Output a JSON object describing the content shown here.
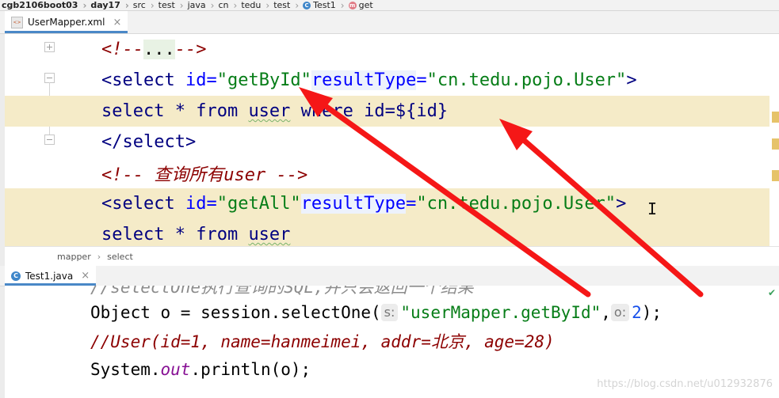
{
  "breadcrumb": [
    "cgb2106boot03",
    "day17",
    "src",
    "test",
    "java",
    "cn",
    "tedu",
    "test",
    "Test1",
    "get"
  ],
  "tabs": {
    "xml_tab": "UserMapper.xml",
    "java_tab": "Test1.java",
    "xml_icon": "<>",
    "java_icon": "C"
  },
  "xml": {
    "collapsed_comment": {
      "open": "<!--",
      "dots": "...",
      "close": "-->"
    },
    "select1": {
      "lt": "<select ",
      "id_attr": "id",
      "eq": "=",
      "id_val": "\"getById\"",
      "rt_attr": "resultType",
      "eq2": "=",
      "rt_val": "\"cn.tedu.pojo.User\"",
      "gt": ">"
    },
    "sql1": {
      "a": "select * from ",
      "b": "user",
      "c": " where id=${id}"
    },
    "close1": "</select>",
    "comment2": "<!-- 查询所有user -->",
    "select2": {
      "lt": "<select ",
      "id_attr": "id",
      "eq": "=",
      "id_val": "\"getAll\"",
      "rt_attr": "resultType",
      "eq2": "=",
      "rt_val": "\"cn.tedu.pojo.User\"",
      "gt": ">"
    },
    "sql2": {
      "a": "select * from ",
      "b": "user"
    }
  },
  "status_crumb": {
    "a": "mapper",
    "b": "select"
  },
  "java": {
    "line0": "//selectOne执行查询的SQL,并只会返回一个结果",
    "line1": {
      "a": "Object o = session.selectOne(",
      "hint_s": "s:",
      "str": "\"userMapper.getById\"",
      "comma": ",",
      "hint_o": "o:",
      "num": "2",
      "end": ");"
    },
    "line2": "//User(id=1, name=hanmeimei, addr=北京, age=28)",
    "line3": {
      "a": "System.",
      "field": "out",
      "b": ".println(o);"
    }
  },
  "watermark": "https://blog.csdn.net/u012932876",
  "colors": {
    "arrow": "#f51717",
    "highlight": "#f5ebc8",
    "tab_accent": "#4a88c7"
  }
}
